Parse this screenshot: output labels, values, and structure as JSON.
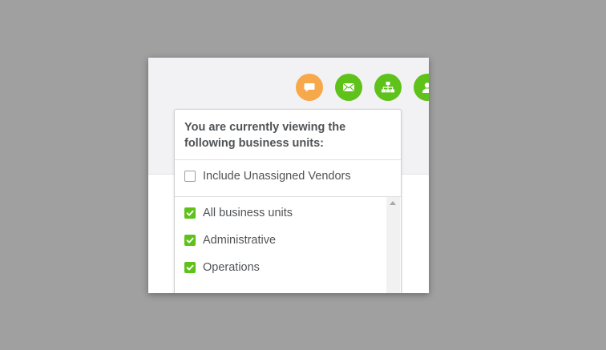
{
  "header": {
    "icons": [
      {
        "name": "chat-icon",
        "color": "#f6a84a"
      },
      {
        "name": "mail-icon",
        "color": "#5ec21a"
      },
      {
        "name": "org-chart-icon",
        "color": "#5ec21a"
      },
      {
        "name": "user-icon",
        "color": "#5ec21a"
      }
    ]
  },
  "dropdown": {
    "title": "You are currently viewing the following business units:",
    "include_unassigned": {
      "label": "Include Unassigned Vendors",
      "checked": false
    },
    "units": [
      {
        "label": "All business units",
        "checked": true
      },
      {
        "label": "Administrative",
        "checked": true
      },
      {
        "label": "Operations",
        "checked": true
      }
    ]
  },
  "colors": {
    "accent_green": "#5ec21a",
    "accent_orange": "#f6a84a",
    "text": "#505356"
  }
}
